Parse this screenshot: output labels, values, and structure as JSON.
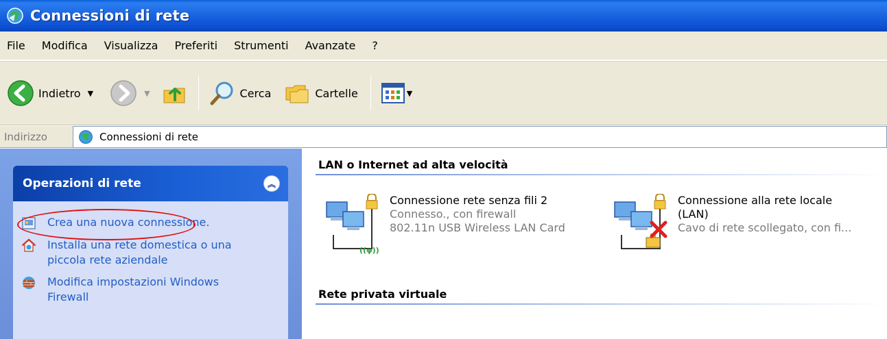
{
  "window": {
    "title": "Connessioni di rete"
  },
  "menubar": {
    "items": [
      "File",
      "Modifica",
      "Visualizza",
      "Preferiti",
      "Strumenti",
      "Avanzate",
      "?"
    ]
  },
  "toolbar": {
    "back_label": "Indietro",
    "search_label": "Cerca",
    "folders_label": "Cartelle"
  },
  "addressbar": {
    "label": "Indirizzo",
    "value": "Connessioni di rete"
  },
  "tasks_panel": {
    "title": "Operazioni di rete",
    "items": [
      {
        "label": "Crea una nuova connessione."
      },
      {
        "label": "Installa una rete domestica o una piccola rete aziendale"
      },
      {
        "label": "Modifica impostazioni Windows Firewall"
      }
    ]
  },
  "groups": [
    {
      "header": "LAN o Internet ad alta velocità",
      "connections": [
        {
          "name": "Connessione rete senza fili 2",
          "status": "Connesso., con firewall",
          "device": "802.11n USB Wireless LAN Card"
        },
        {
          "name": "Connessione alla rete locale (LAN)",
          "status": "Cavo di rete scollegato, con fi..."
        }
      ]
    },
    {
      "header": "Rete privata virtuale",
      "connections": []
    }
  ],
  "colors": {
    "titlebar_blue": "#0b50d2",
    "chrome_beige": "#ece9d8",
    "task_link_blue": "#215dc6",
    "highlight_red": "#e01010"
  },
  "icons": [
    "network-globe-icon",
    "back-arrow-icon",
    "forward-arrow-icon",
    "folder-up-icon",
    "search-magnifier-icon",
    "folders-icon",
    "views-icon",
    "new-connection-icon",
    "home-network-icon",
    "firewall-icon",
    "network-computers-icon",
    "disconnected-x-icon"
  ]
}
